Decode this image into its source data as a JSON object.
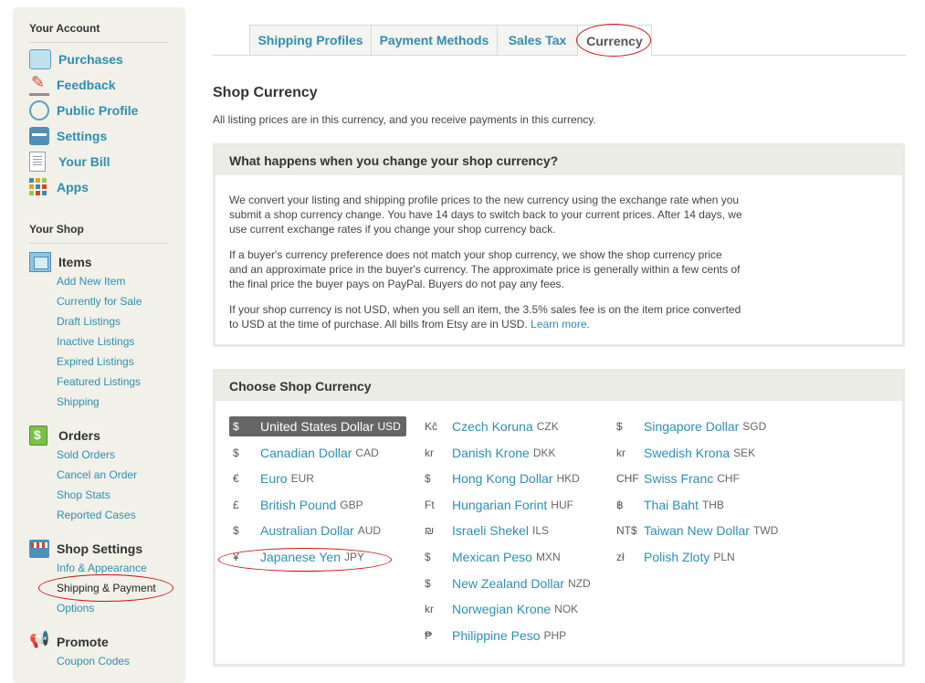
{
  "sidebar": {
    "account_title": "Your Account",
    "account_items": [
      {
        "label": "Purchases",
        "icon": "purchases-icon"
      },
      {
        "label": "Feedback",
        "icon": "feedback-icon"
      },
      {
        "label": "Public Profile",
        "icon": "public-profile-icon"
      },
      {
        "label": "Settings",
        "icon": "settings-icon"
      },
      {
        "label": "Your Bill",
        "icon": "bill-icon"
      },
      {
        "label": "Apps",
        "icon": "apps-icon"
      }
    ],
    "shop_title": "Your Shop",
    "items_group": {
      "label": "Items",
      "links": [
        "Add New Item",
        "Currently for Sale",
        "Draft Listings",
        "Inactive Listings",
        "Expired Listings",
        "Featured Listings",
        "Shipping"
      ]
    },
    "orders_group": {
      "label": "Orders",
      "links": [
        "Sold Orders",
        "Cancel an Order",
        "Shop Stats",
        "Reported Cases"
      ]
    },
    "settings_group": {
      "label": "Shop Settings",
      "links": [
        "Info & Appearance",
        "Shipping & Payment",
        "Options"
      ]
    },
    "promote_group": {
      "label": "Promote",
      "links": [
        "Coupon Codes"
      ]
    }
  },
  "tabs": [
    "Shipping Profiles",
    "Payment Methods",
    "Sales Tax",
    "Currency"
  ],
  "active_tab": "Currency",
  "page": {
    "title": "Shop Currency",
    "subtitle": "All listing prices are in this currency, and you receive payments in this currency."
  },
  "info_panel": {
    "heading": "What happens when you change your shop currency?",
    "p1": "We convert your listing and shipping profile prices to the new currency using the exchange rate when you submit a shop currency change. You have 14 days to switch back to your current prices. After 14 days, we use current exchange rates if you change your shop currency back.",
    "p2": "If a buyer's currency preference does not match your shop currency, we show the shop currency price and an approximate price in the buyer's currency. The approximate price is generally within a few cents of the final price the buyer pays on PayPal. Buyers do not pay any fees.",
    "p3": "If your shop currency is not USD, when you sell an item, the 3.5% sales fee is on the item price converted to USD at the time of purchase. All bills from Etsy are in USD.",
    "learn_more": "Learn more."
  },
  "currency_panel": {
    "heading": "Choose Shop Currency",
    "selected": "USD",
    "columns": [
      [
        {
          "sym": "$",
          "name": "United States Dollar",
          "code": "USD"
        },
        {
          "sym": "$",
          "name": "Canadian Dollar",
          "code": "CAD"
        },
        {
          "sym": "€",
          "name": "Euro",
          "code": "EUR"
        },
        {
          "sym": "£",
          "name": "British Pound",
          "code": "GBP"
        },
        {
          "sym": "$",
          "name": "Australian Dollar",
          "code": "AUD"
        },
        {
          "sym": "¥",
          "name": "Japanese Yen",
          "code": "JPY"
        }
      ],
      [
        {
          "sym": "Kč",
          "name": "Czech Koruna",
          "code": "CZK"
        },
        {
          "sym": "kr",
          "name": "Danish Krone",
          "code": "DKK"
        },
        {
          "sym": "$",
          "name": "Hong Kong Dollar",
          "code": "HKD"
        },
        {
          "sym": "Ft",
          "name": "Hungarian Forint",
          "code": "HUF"
        },
        {
          "sym": "₪",
          "name": "Israeli Shekel",
          "code": "ILS"
        },
        {
          "sym": "$",
          "name": "Mexican Peso",
          "code": "MXN"
        },
        {
          "sym": "$",
          "name": "New Zealand Dollar",
          "code": "NZD"
        },
        {
          "sym": "kr",
          "name": "Norwegian Krone",
          "code": "NOK"
        },
        {
          "sym": "₱",
          "name": "Philippine Peso",
          "code": "PHP"
        }
      ],
      [
        {
          "sym": "$",
          "name": "Singapore Dollar",
          "code": "SGD"
        },
        {
          "sym": "kr",
          "name": "Swedish Krona",
          "code": "SEK"
        },
        {
          "sym": "CHF",
          "name": "Swiss Franc",
          "code": "CHF"
        },
        {
          "sym": "฿",
          "name": "Thai Baht",
          "code": "THB"
        },
        {
          "sym": "NT$",
          "name": "Taiwan New Dollar",
          "code": "TWD"
        },
        {
          "sym": "zł",
          "name": "Polish Zloty",
          "code": "PLN"
        }
      ]
    ]
  },
  "colors": {
    "link": "#2e8fb0",
    "annotation": "#cc1111",
    "selected_bg": "#666666"
  }
}
